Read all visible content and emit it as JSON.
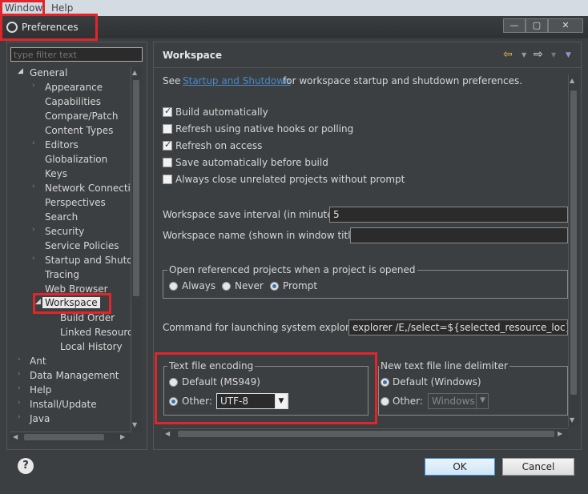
{
  "menubar": {
    "window": "Window",
    "help": "Help"
  },
  "dialog": {
    "title": "Preferences"
  },
  "filter": {
    "placeholder": "type filter text"
  },
  "tree": {
    "general": "General",
    "appearance": "Appearance",
    "capabilities": "Capabilities",
    "compare_patch": "Compare/Patch",
    "content_types": "Content Types",
    "editors": "Editors",
    "globalization": "Globalization",
    "keys": "Keys",
    "network_connections": "Network Connection",
    "perspectives": "Perspectives",
    "search": "Search",
    "security": "Security",
    "service_policies": "Service Policies",
    "startup_shutdown": "Startup and Shutdo",
    "tracing": "Tracing",
    "web_browser": "Web Browser",
    "workspace": "Workspace",
    "build_order": "Build Order",
    "linked_resources": "Linked Resource",
    "local_history": "Local History",
    "ant": "Ant",
    "data_management": "Data Management",
    "help": "Help",
    "install_update": "Install/Update",
    "java": "Java"
  },
  "page": {
    "title": "Workspace",
    "see_prefix": "See ",
    "see_link": "Startup and Shutdown",
    "see_suffix": " for workspace startup and shutdown preferences.",
    "build_automatically": "Build automatically",
    "refresh_native": "Refresh using native hooks or polling",
    "refresh_on_access": "Refresh on access",
    "save_before_build": "Save automatically before build",
    "close_unrelated": "Always close unrelated projects without prompt",
    "save_interval_label": "Workspace save interval (in minutes):",
    "save_interval_value": "5",
    "ws_name_label": "Workspace name (shown in window title):",
    "ws_name_value": "",
    "open_ref_group": "Open referenced projects when a project is opened",
    "always": "Always",
    "never": "Never",
    "prompt": "Prompt",
    "explorer_label": "Command for launching system explorer:",
    "explorer_value": "explorer /E,/select=${selected_resource_loc}",
    "encoding_group": "Text file encoding",
    "encoding_default": "Default (MS949)",
    "encoding_other": "Other:",
    "encoding_value": "UTF-8",
    "delim_group": "New text file line delimiter",
    "delim_default": "Default (Windows)",
    "delim_other": "Other:",
    "delim_value": "Windows"
  },
  "buttons": {
    "ok": "OK",
    "cancel": "Cancel"
  },
  "colors": {
    "highlight": "#e0262a",
    "background": "#3c3f41",
    "link": "#4a88c7"
  }
}
